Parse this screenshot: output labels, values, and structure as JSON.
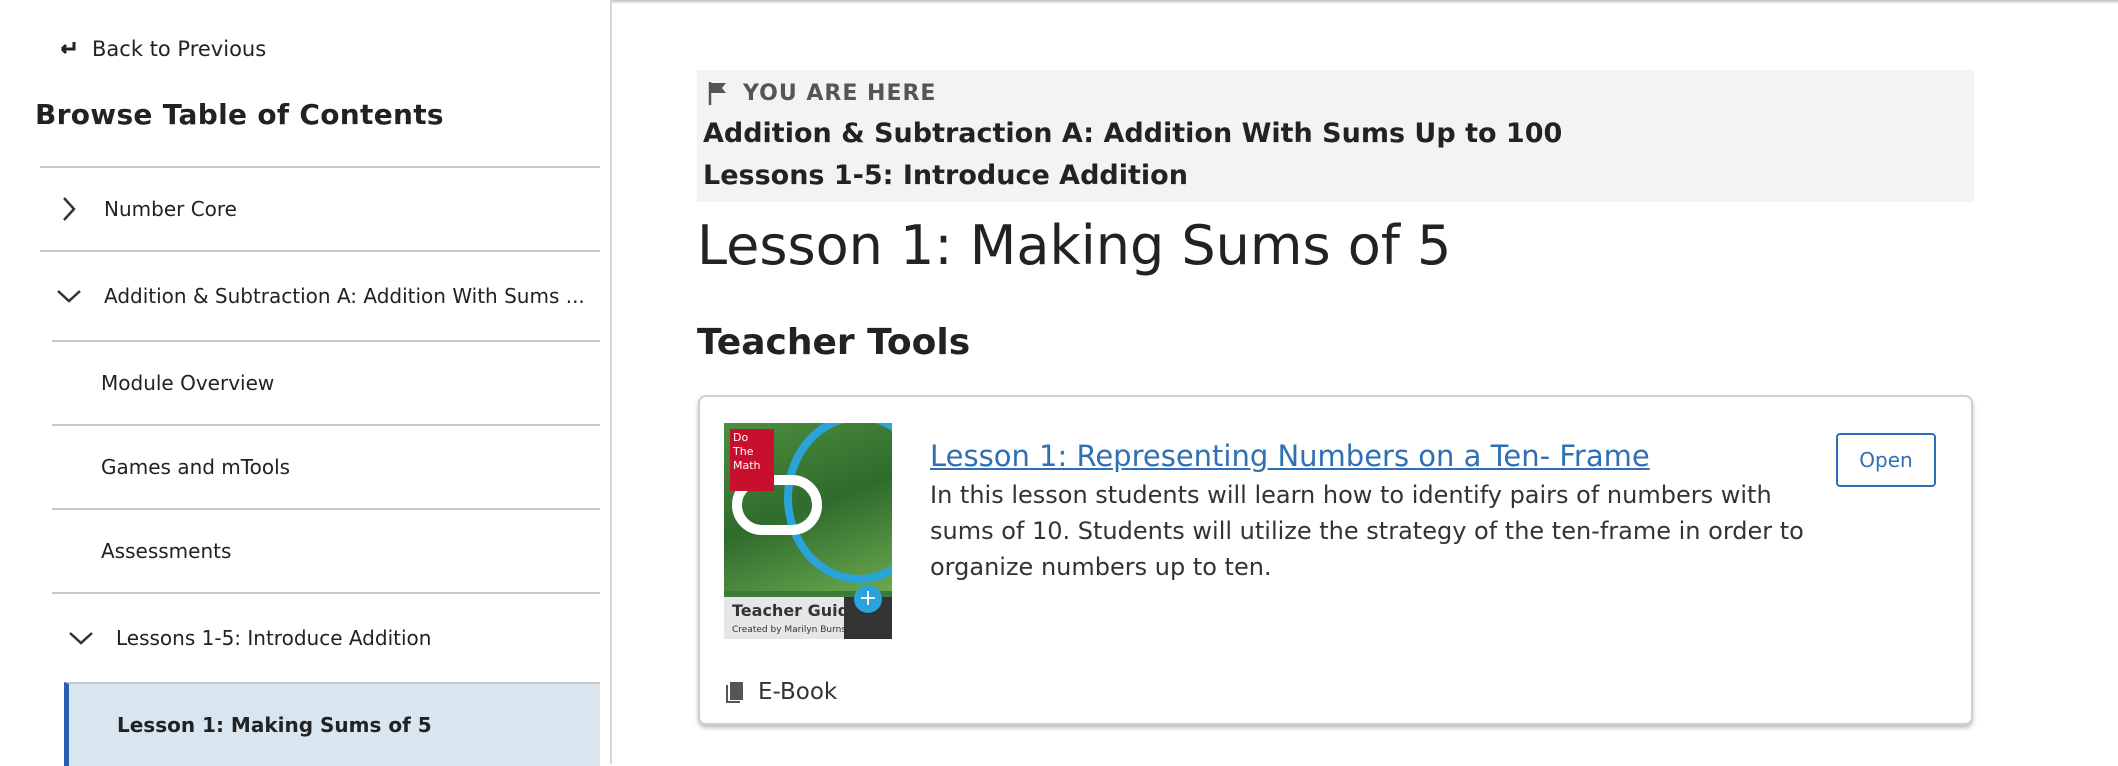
{
  "sidebar": {
    "back_label": "Back to Previous",
    "toc_title": "Browse Table of Contents",
    "items": [
      {
        "label": "Number Core"
      },
      {
        "label": "Addition & Subtraction A: Addition With Sums ..."
      },
      {
        "label": "Module Overview"
      },
      {
        "label": "Games and mTools"
      },
      {
        "label": "Assessments"
      },
      {
        "label": "Lessons 1-5: Introduce Addition"
      },
      {
        "label": "Lesson 1: Making Sums of 5"
      }
    ]
  },
  "breadcrumb": {
    "you_are_here": "YOU ARE HERE",
    "level1": "Addition & Subtraction A: Addition With Sums Up to 100",
    "level2": "Lessons 1-5: Introduce Addition"
  },
  "main": {
    "page_title": "Lesson 1: Making Sums of 5",
    "section_title": "Teacher Tools",
    "resource": {
      "title": "Lesson 1: Representing Numbers on a Ten- Frame",
      "description": "In this lesson students will learn how to identify pairs of numbers with sums of 10. Students will utilize the strategy of the ten-frame in order to organize numbers up to ten.",
      "open_label": "Open",
      "format_label": "E-Book",
      "cover": {
        "badge": "Do The Math",
        "guide": "Teacher Guide",
        "author": "Created by Marilyn Burns"
      }
    }
  },
  "colors": {
    "link": "#2f6fb3",
    "selected_bg": "#d9e5ef",
    "selected_border": "#2b5fb0"
  }
}
